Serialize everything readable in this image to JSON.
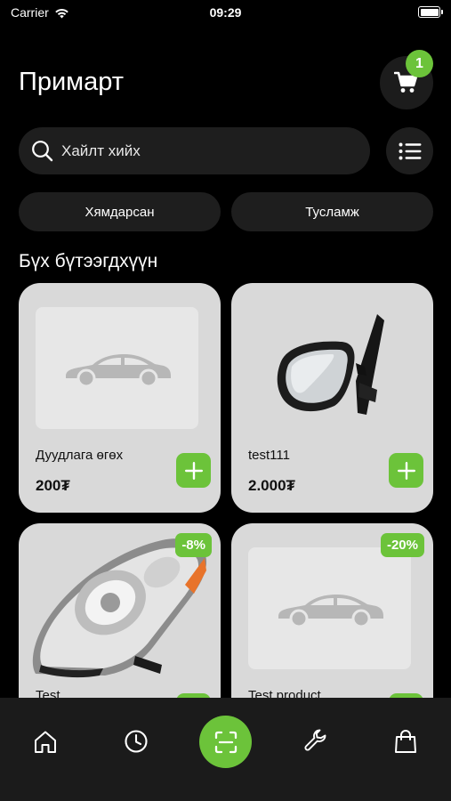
{
  "status_bar": {
    "carrier": "Carrier",
    "time": "09:29"
  },
  "header": {
    "title": "Примарт",
    "cart_count": "1"
  },
  "search": {
    "placeholder": "Хайлт хийх"
  },
  "chips": [
    "Хямдарсан",
    "Тусламж"
  ],
  "section_title": "Бүх бүтээгдхүүн",
  "products": [
    {
      "name": "Дуудлага өгөх",
      "price": "200₮",
      "image": "car-placeholder-icon"
    },
    {
      "name": "test111",
      "price": "2.000₮",
      "image": "side-mirror"
    },
    {
      "name": "Test",
      "discount": "-8%",
      "image": "headlight"
    },
    {
      "name": "Test product",
      "discount": "-20%",
      "image": "car-placeholder-icon"
    }
  ],
  "bottom_nav": [
    "home-icon",
    "history-clock-icon",
    "scan-icon",
    "wrench-icon",
    "shopping-bag-icon"
  ],
  "colors": {
    "accent": "#6cc33a",
    "background": "#000000",
    "surface": "#1e1e1e",
    "card": "#d9d9d9"
  }
}
